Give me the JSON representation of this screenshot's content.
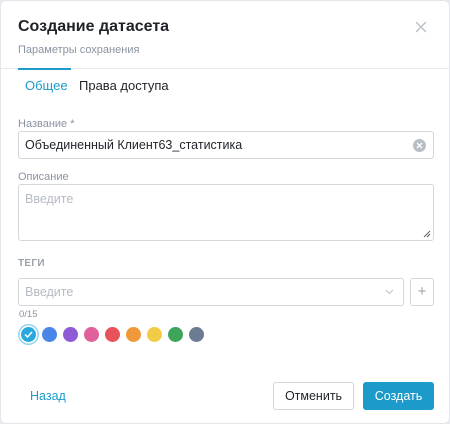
{
  "dialog": {
    "title": "Создание датасета",
    "subtitle": "Параметры сохранения"
  },
  "tabs": [
    {
      "label": "Общее",
      "active": true
    },
    {
      "label": "Права доступа",
      "active": false
    }
  ],
  "form": {
    "name_label": "Название *",
    "name_value": "Объединенный Клиент63_статистика",
    "description_label": "Описание",
    "description_placeholder": "Введите",
    "tags_heading": "ТЕГИ",
    "tags_placeholder": "Введите",
    "tags_counter": "0/15",
    "add_tag_label": "+"
  },
  "colors": [
    {
      "hex": "#29a8e0",
      "selected": true
    },
    {
      "hex": "#4a86e8",
      "selected": false
    },
    {
      "hex": "#8e5bd6",
      "selected": false
    },
    {
      "hex": "#e0609b",
      "selected": false
    },
    {
      "hex": "#e8525a",
      "selected": false
    },
    {
      "hex": "#f0993a",
      "selected": false
    },
    {
      "hex": "#f3cc45",
      "selected": false
    },
    {
      "hex": "#3fa55b",
      "selected": false
    },
    {
      "hex": "#6b7c92",
      "selected": false
    }
  ],
  "footer": {
    "back_label": "Назад",
    "cancel_label": "Отменить",
    "create_label": "Создать"
  },
  "accent_color": "#1c9bcb"
}
